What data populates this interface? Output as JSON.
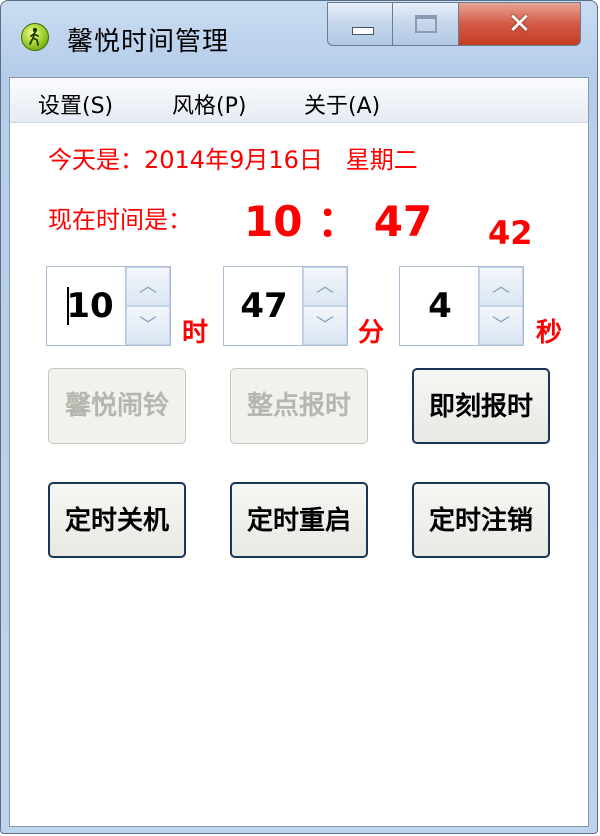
{
  "window": {
    "title": "馨悦时间管理",
    "close_glyph": "✕"
  },
  "menu": [
    {
      "label": "设置(S)"
    },
    {
      "label": "风格(P)"
    },
    {
      "label": "关于(A)"
    }
  ],
  "info": {
    "date_line": "今天是：2014年9月16日   星期二",
    "time_label": "现在时间是：",
    "time_display": "10 ： 47",
    "seconds_display": "42"
  },
  "spinners": [
    {
      "value": "10",
      "unit": "时"
    },
    {
      "value": "47",
      "unit": "分"
    },
    {
      "value": "4",
      "unit": "秒"
    }
  ],
  "buttons": {
    "row1": [
      {
        "label": "馨悦闹铃",
        "enabled": false
      },
      {
        "label": "整点报时",
        "enabled": false
      },
      {
        "label": "即刻报时",
        "enabled": true
      }
    ],
    "row2": [
      {
        "label": "定时关机",
        "enabled": true
      },
      {
        "label": "定时重启",
        "enabled": true
      },
      {
        "label": "定时注销",
        "enabled": true
      }
    ]
  },
  "icons": {
    "app": "walking-person-icon",
    "spin_up": "chevron-up-icon",
    "spin_down": "chevron-down-icon"
  },
  "colors": {
    "accent_text": "#ff0000",
    "close_button": "#d45a45",
    "title_bar": "#c9dcf2"
  }
}
